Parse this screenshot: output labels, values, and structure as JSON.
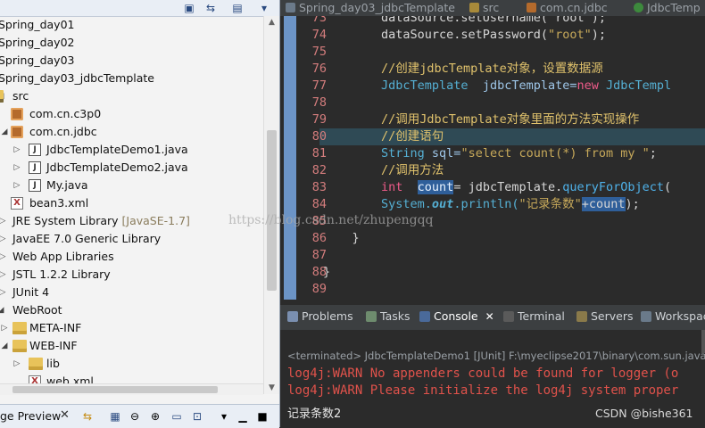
{
  "explorer": {
    "toolbar_icons": [
      "collapse-all-icon",
      "link-editor-icon",
      "view-menu-icon",
      "chevron-down-icon"
    ],
    "items": [
      {
        "label": "Spring_day01",
        "extra": "",
        "icon": "project-icon"
      },
      {
        "label": "Spring_day02",
        "extra": "",
        "icon": "project-icon"
      },
      {
        "label": "Spring_day03",
        "extra": "",
        "icon": "project-icon"
      },
      {
        "label": "Spring_day03_jdbcTemplate",
        "extra": "",
        "icon": "project-icon"
      },
      {
        "label": "src",
        "extra": "",
        "icon": "source-folder-icon"
      },
      {
        "label": "com.cn.c3p0",
        "extra": "",
        "icon": "package-icon"
      },
      {
        "label": "com.cn.jdbc",
        "extra": "",
        "icon": "package-icon"
      },
      {
        "label": "JdbcTemplateDemo1.java",
        "extra": "",
        "icon": "java-file-icon"
      },
      {
        "label": "JdbcTemplateDemo2.java",
        "extra": "",
        "icon": "java-file-icon"
      },
      {
        "label": "My.java",
        "extra": "",
        "icon": "java-file-icon"
      },
      {
        "label": "bean3.xml",
        "extra": "",
        "icon": "xml-file-icon"
      },
      {
        "label": "JRE System Library ",
        "extra": "[JavaSE-1.7]",
        "icon": "library-icon"
      },
      {
        "label": "JavaEE 7.0 Generic Library",
        "extra": "",
        "icon": "library-icon"
      },
      {
        "label": "Web App Libraries",
        "extra": "",
        "icon": "library-icon"
      },
      {
        "label": "JSTL 1.2.2 Library",
        "extra": "",
        "icon": "library-icon"
      },
      {
        "label": "JUnit 4",
        "extra": "",
        "icon": "library-icon"
      },
      {
        "label": "WebRoot",
        "extra": "",
        "icon": "folder-icon"
      },
      {
        "label": "META-INF",
        "extra": "",
        "icon": "folder-icon"
      },
      {
        "label": "WEB-INF",
        "extra": "",
        "icon": "folder-icon"
      },
      {
        "label": "lib",
        "extra": "",
        "icon": "folder-icon"
      },
      {
        "label": "web.xml",
        "extra": "",
        "icon": "xml-file-icon"
      }
    ],
    "bottom_tab": "ge Preview"
  },
  "editor": {
    "tabs": [
      "Spring_day03_jdbcTemplate",
      "src",
      "com.cn.jdbc",
      "JdbcTemp"
    ],
    "line_numbers": [
      "73",
      "74",
      "75",
      "76",
      "77",
      "78",
      "79",
      "80",
      "81",
      "82",
      "83",
      "84",
      "85",
      "86",
      "87",
      "88",
      "89"
    ],
    "code": {
      "l73": "        dataSource.setUsername(\"root\");",
      "l74_a": "        dataSource.setPassword(",
      "l74_b": "\"root\"",
      "l74_c": ");",
      "l76": "        //创建jdbcTemplate对象，设置数据源",
      "l77_a": "        JdbcTemplate",
      "l77_b": "  jdbcTemplate=",
      "l77_c": "new",
      "l77_d": " JdbcTempl",
      "l79": "        //调用JdbcTemplate对象里面的方法实现操作",
      "l80": "        //创建语句",
      "l81_a": "        String",
      "l81_b": " sql=",
      "l81_c": "\"select count(*) from my \"",
      "l81_d": ";",
      "l82": "        //调用方法",
      "l83_a": "        int",
      "l83_b": "  ",
      "l83_c": "count",
      "l83_d": "= jdbcTemplate.",
      "l83_e": "queryForObject",
      "l83_f": "(",
      "l84_a": "        System.",
      "l84_b": "out",
      "l84_c": ".println(",
      "l84_d": "\"记录条数\"",
      "l84_e": "+count",
      "l84_f": ");",
      "l86": "    }",
      "l88": "}"
    }
  },
  "console": {
    "tabs": [
      "Problems",
      "Tasks",
      "Console",
      "Terminal",
      "Servers",
      "Workspac"
    ],
    "status": "<terminated> JdbcTemplateDemo1 [JUnit] F:\\myeclipse2017\\binary\\com.sun.java",
    "log1": "log4j:WARN No appenders could be found for logger (o",
    "log2": "log4j:WARN Please initialize the log4j system proper",
    "output": "记录条数2"
  },
  "watermarks": {
    "url": "https://blog.csdn.net/zhupengqq",
    "csdn": "CSDN @bishe361"
  }
}
